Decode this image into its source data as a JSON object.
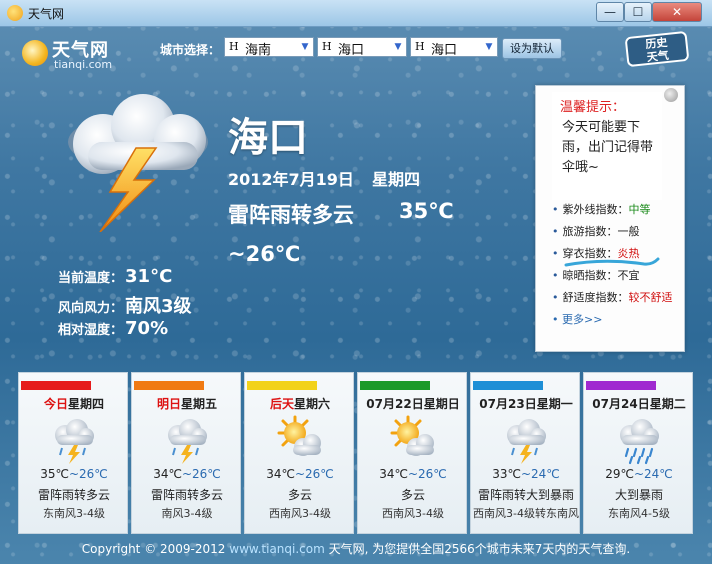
{
  "window": {
    "title": "天气网",
    "buttons": {
      "min": "—",
      "max": "☐",
      "close": "✕"
    }
  },
  "logo": {
    "name": "天气网",
    "domain": "tianqi.com"
  },
  "city_select": {
    "label": "城市选择：",
    "province": {
      "prefix": "H",
      "value": "海南"
    },
    "city": {
      "prefix": "H",
      "value": "海口"
    },
    "district": {
      "prefix": "H",
      "value": "海口"
    },
    "set_default": "设为默认"
  },
  "history_button": {
    "line1": "历史",
    "line2": "天气"
  },
  "current": {
    "city": "海口",
    "date": "2012年7月19日",
    "weekday": "星期四",
    "condition": "雷阵雨转多云",
    "high": "35℃",
    "low": "~26℃",
    "icon": "thunderstorm-icon",
    "stats": [
      {
        "key": "当前温度：",
        "value": "31°C"
      },
      {
        "key": "风向风力：",
        "value": "南风3级"
      },
      {
        "key": "相对湿度：",
        "value": "70%"
      }
    ]
  },
  "tips": {
    "title": "温馨提示：",
    "text": "今天可能要下雨，出门记得带伞哦~"
  },
  "indexes": [
    {
      "key": "紫外线指数：",
      "value": "中等",
      "color": "#1a8a1a"
    },
    {
      "key": "旅游指数：",
      "value": "一般",
      "color": "#222222"
    },
    {
      "key": "穿衣指数：",
      "value": "炎热",
      "color": "#d11111"
    },
    {
      "key": "晾晒指数：",
      "value": "不宜",
      "color": "#222222"
    },
    {
      "key": "舒适度指数：",
      "value": "较不舒适",
      "color": "#d11111"
    }
  ],
  "more": "更多>>",
  "forecast": [
    {
      "prefix": "今日",
      "suffix": "星期四",
      "bar_color": "#e61b1b",
      "icon": "thunderstorm-icon",
      "high": "35℃",
      "low": "~26℃",
      "condition": "雷阵雨转多云",
      "wind": "东南风3-4级"
    },
    {
      "prefix": "明日",
      "suffix": "星期五",
      "bar_color": "#f07a12",
      "icon": "thunderstorm-icon",
      "high": "34℃",
      "low": "~26℃",
      "condition": "雷阵雨转多云",
      "wind": "南风3-4级"
    },
    {
      "prefix": "后天",
      "suffix": "星期六",
      "bar_color": "#f2d21a",
      "icon": "partly-cloudy-icon",
      "high": "34℃",
      "low": "~26℃",
      "condition": "多云",
      "wind": "西南风3-4级"
    },
    {
      "prefix": "",
      "suffix": "07月22日星期日",
      "bar_color": "#1c9a2a",
      "icon": "partly-cloudy-icon",
      "high": "34℃",
      "low": "~26℃",
      "condition": "多云",
      "wind": "西南风3-4级"
    },
    {
      "prefix": "",
      "suffix": "07月23日星期一",
      "bar_color": "#1e8fd6",
      "icon": "thunderstorm-icon",
      "high": "33℃",
      "low": "~24℃",
      "condition": "雷阵雨转大到暴雨",
      "wind": "西南风3-4级转东南风"
    },
    {
      "prefix": "",
      "suffix": "07月24日星期二",
      "bar_color": "#a02ad0",
      "icon": "heavy-rain-icon",
      "high": "29℃",
      "low": "~24℃",
      "condition": "大到暴雨",
      "wind": "东南风4-5级"
    }
  ],
  "footer": {
    "before": "Copyright © 2009-2012 ",
    "link": "www.tianqi.com",
    "after": " 天气网, 为您提供全国2566个城市未来7天内的天气查询."
  }
}
